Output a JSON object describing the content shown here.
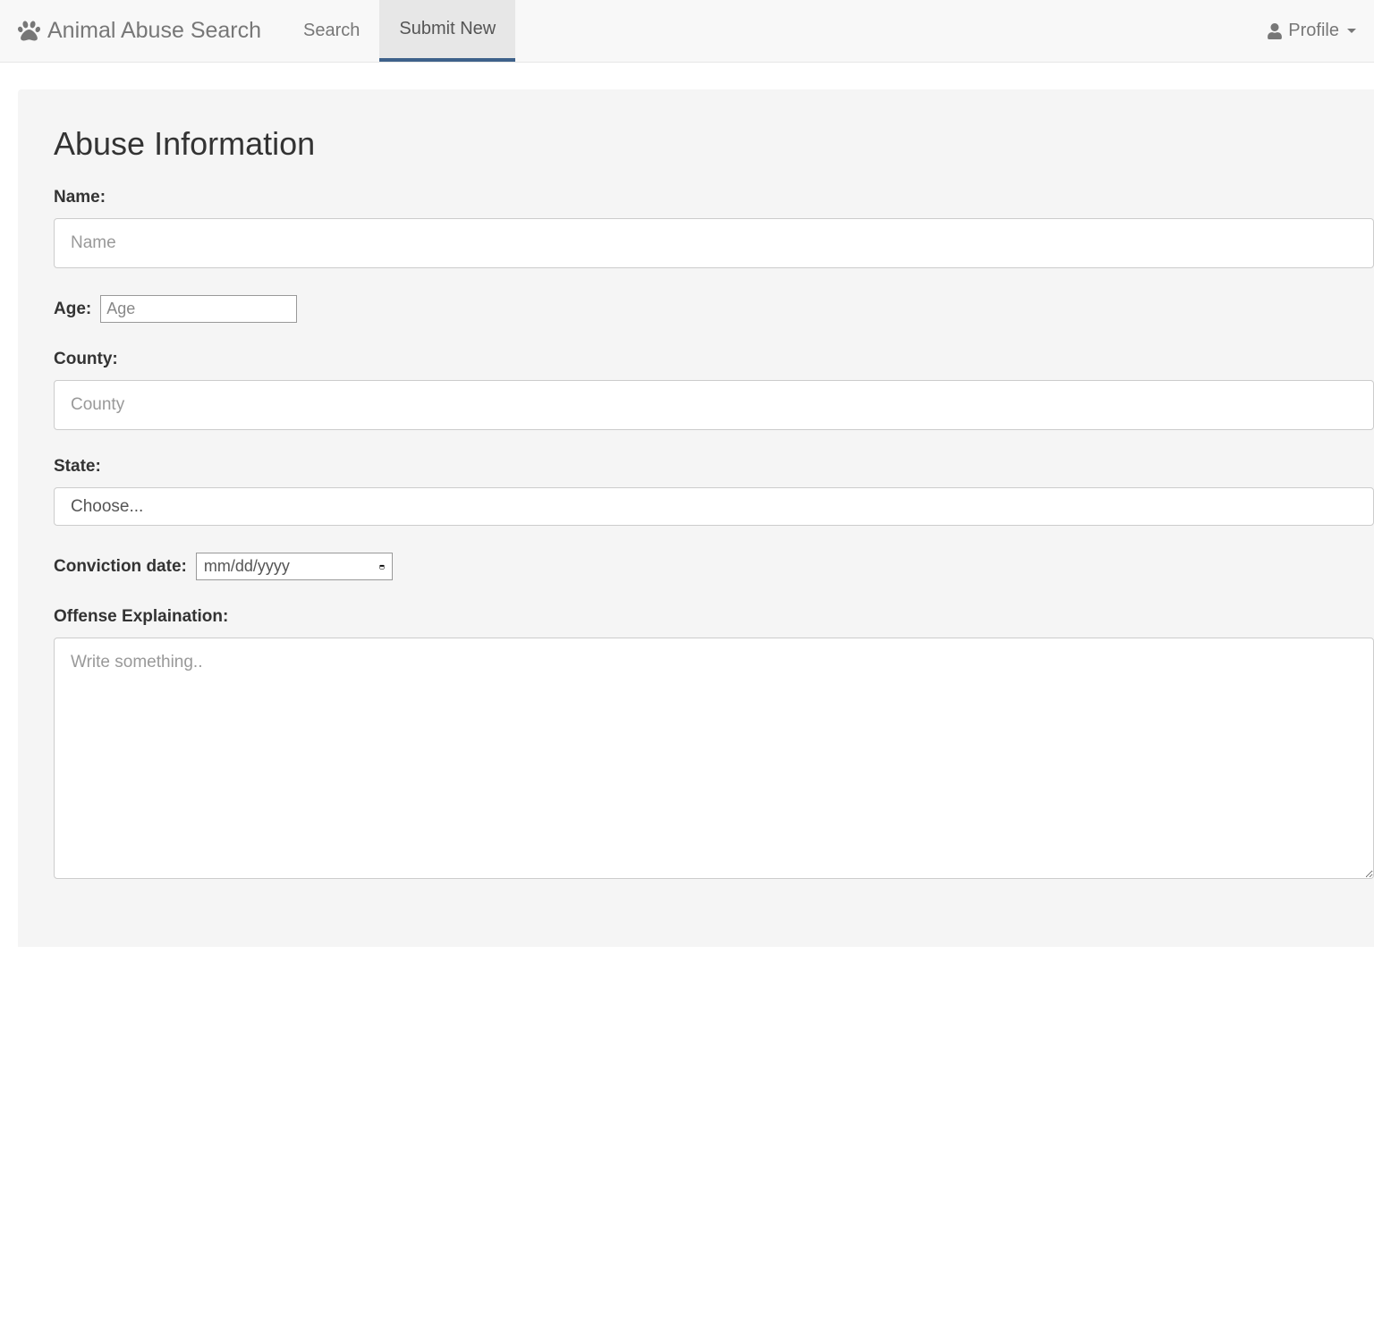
{
  "navbar": {
    "brand": "Animal Abuse Search",
    "items": [
      {
        "label": "Search",
        "active": false
      },
      {
        "label": "Submit New",
        "active": true
      }
    ],
    "profile_label": "Profile"
  },
  "form": {
    "title": "Abuse Information",
    "name": {
      "label": "Name:",
      "placeholder": "Name",
      "value": ""
    },
    "age": {
      "label": "Age:",
      "placeholder": "Age",
      "value": ""
    },
    "county": {
      "label": "County:",
      "placeholder": "County",
      "value": ""
    },
    "state": {
      "label": "State:",
      "selected": "Choose..."
    },
    "conviction_date": {
      "label": "Conviction date:",
      "placeholder": "mm/dd/yyyy",
      "value": ""
    },
    "offense": {
      "label": "Offense Explaination:",
      "placeholder": "Write something..",
      "value": ""
    }
  }
}
